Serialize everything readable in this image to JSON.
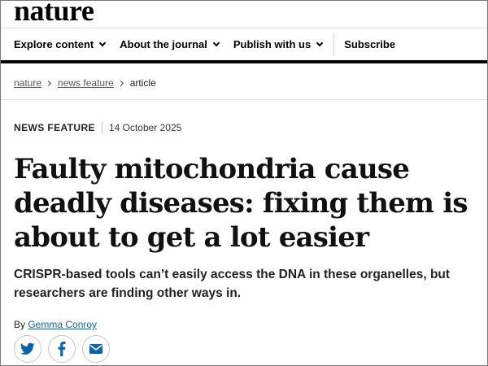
{
  "site": {
    "logo": "nature"
  },
  "nav": {
    "items": [
      {
        "label": "Explore content"
      },
      {
        "label": "About the journal"
      },
      {
        "label": "Publish with us"
      }
    ],
    "subscribe": "Subscribe"
  },
  "breadcrumb": {
    "items": [
      {
        "label": "nature"
      },
      {
        "label": "news feature"
      },
      {
        "label": "article"
      }
    ]
  },
  "article": {
    "type": "NEWS FEATURE",
    "date": "14 October 2025",
    "title": "Faulty mitochondria cause deadly diseases: fixing them is about to get a lot easier",
    "standfirst": "CRISPR-based tools can’t easily access the DNA in these organelles, but researchers are finding other ways in.",
    "byline_prefix": "By ",
    "author": "Gemma Conroy"
  },
  "share": {
    "icons": [
      "twitter-icon",
      "facebook-icon",
      "email-icon"
    ],
    "accent": "#0b63a8"
  }
}
